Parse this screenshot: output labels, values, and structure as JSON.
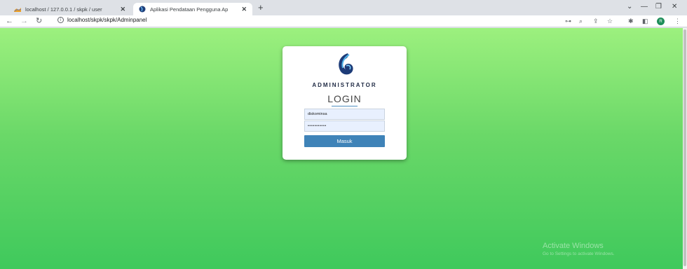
{
  "browser": {
    "tabs": [
      {
        "title": "localhost / 127.0.0.1 / skpk / user",
        "favicon": "phpmyadmin-icon",
        "active": false
      },
      {
        "title": "Aplikasi Pendataan Pengguna Ap",
        "favicon": "globe-icon",
        "active": true
      }
    ],
    "url": "localhost/skpk/skpk/Adminpanel",
    "profile_initial": "R",
    "profile_color": "#1e8e5a"
  },
  "login": {
    "heading": "ADMINISTRATOR",
    "title": "LOGIN",
    "username_value": "diskominsa",
    "password_value": "•••••••••••",
    "submit_label": "Masuk",
    "button_color": "#3f83b8"
  },
  "watermark": {
    "title": "Activate Windows",
    "subtitle": "Go to Settings to activate Windows."
  },
  "colors": {
    "background_top": "#9cf07e",
    "background_bottom": "#3fc95c"
  }
}
